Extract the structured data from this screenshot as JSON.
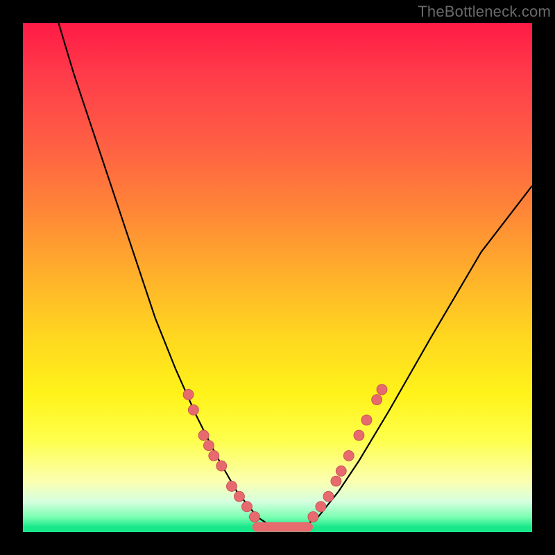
{
  "watermark": "TheBottleneck.com",
  "chart_data": {
    "type": "line",
    "title": "",
    "xlabel": "",
    "ylabel": "",
    "xlim": [
      0,
      100
    ],
    "ylim": [
      0,
      100
    ],
    "grid": false,
    "legend": false,
    "curve": [
      {
        "x": 7,
        "y": 100
      },
      {
        "x": 10,
        "y": 90
      },
      {
        "x": 14,
        "y": 78
      },
      {
        "x": 18,
        "y": 66
      },
      {
        "x": 22,
        "y": 54
      },
      {
        "x": 26,
        "y": 42
      },
      {
        "x": 30,
        "y": 32
      },
      {
        "x": 34,
        "y": 23
      },
      {
        "x": 38,
        "y": 15
      },
      {
        "x": 42,
        "y": 8
      },
      {
        "x": 46,
        "y": 3
      },
      {
        "x": 49,
        "y": 1
      },
      {
        "x": 52,
        "y": 1
      },
      {
        "x": 55,
        "y": 1
      },
      {
        "x": 58,
        "y": 3
      },
      {
        "x": 62,
        "y": 8
      },
      {
        "x": 66,
        "y": 14
      },
      {
        "x": 72,
        "y": 24
      },
      {
        "x": 80,
        "y": 38
      },
      {
        "x": 90,
        "y": 55
      },
      {
        "x": 100,
        "y": 68
      }
    ],
    "dots_left": [
      {
        "x": 32.5,
        "y": 27
      },
      {
        "x": 33.5,
        "y": 24
      },
      {
        "x": 35.5,
        "y": 19
      },
      {
        "x": 36.5,
        "y": 17
      },
      {
        "x": 37.5,
        "y": 15
      },
      {
        "x": 39.0,
        "y": 13
      },
      {
        "x": 41.0,
        "y": 9
      },
      {
        "x": 42.5,
        "y": 7
      },
      {
        "x": 44.0,
        "y": 5
      },
      {
        "x": 45.5,
        "y": 3
      }
    ],
    "dots_right": [
      {
        "x": 57.0,
        "y": 3
      },
      {
        "x": 58.5,
        "y": 5
      },
      {
        "x": 60.0,
        "y": 7
      },
      {
        "x": 61.5,
        "y": 10
      },
      {
        "x": 62.5,
        "y": 12
      },
      {
        "x": 64.0,
        "y": 15
      },
      {
        "x": 66.0,
        "y": 19
      },
      {
        "x": 67.5,
        "y": 22
      },
      {
        "x": 69.5,
        "y": 26
      },
      {
        "x": 70.5,
        "y": 28
      }
    ],
    "flat_bottom": {
      "x0": 46,
      "x1": 56,
      "y": 1
    }
  }
}
